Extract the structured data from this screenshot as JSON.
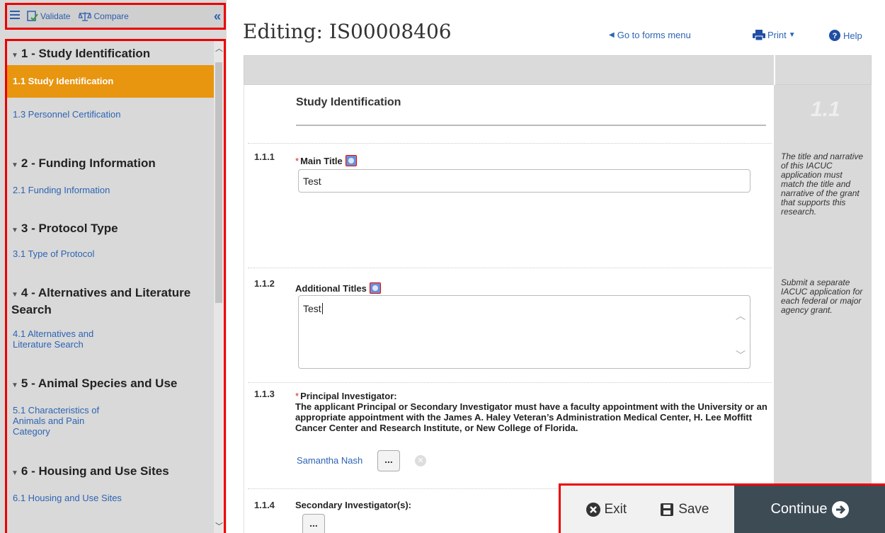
{
  "toolbar": {
    "validate_label": "Validate",
    "compare_label": "Compare"
  },
  "nav": {
    "sections": [
      {
        "heading": "1 - Study Identification",
        "links": [
          "1.1 Study Identification",
          "1.3 Personnel Certification"
        ]
      },
      {
        "heading": "2 - Funding Information",
        "links": [
          "2.1 Funding Information"
        ]
      },
      {
        "heading": "3 - Protocol Type",
        "links": [
          "3.1 Type of Protocol"
        ]
      },
      {
        "heading": "4 - Alternatives and Literature Search",
        "links": [
          "4.1 Alternatives and Literature Search"
        ]
      },
      {
        "heading": "5 - Animal Species and Use",
        "links": [
          "5.1 Characteristics of Animals and Pain Category"
        ]
      },
      {
        "heading": "6 - Housing and Use Sites",
        "links": [
          "6.1 Housing and Use Sites"
        ]
      }
    ],
    "active_link": "1.1 Study Identification"
  },
  "header": {
    "title": "Editing: IS00008406",
    "go_to_forms": "Go to forms menu",
    "print": "Print",
    "help": "Help"
  },
  "form": {
    "section_title": "Study Identification",
    "side_number": "1.1",
    "side_text_1": "The title and narrative of this IACUC application must match the title and narrative of the grant that supports this research.",
    "side_text_2": "Submit a separate IACUC application for each federal or major agency grant.",
    "q1": {
      "num": "1.1.1",
      "label": "Main Title",
      "value": "Test"
    },
    "q2": {
      "num": "1.1.2",
      "label": "Additional Titles",
      "value": "Test"
    },
    "q3": {
      "num": "1.1.3",
      "label": "Principal Investigator:",
      "description": "The applicant Principal or Secondary Investigator must have a faculty appointment with the University or an appropriate appointment with the James A. Haley Veteran’s Administration Medical Center, H. Lee Moffitt Cancer Center and Research Institute, or New College of Florida.",
      "person": "Samantha Nash",
      "button": "..."
    },
    "q4": {
      "num": "1.1.4",
      "label": "Secondary Investigator(s):",
      "button": "..."
    }
  },
  "actions": {
    "exit": "Exit",
    "save": "Save",
    "continue": "Continue"
  }
}
